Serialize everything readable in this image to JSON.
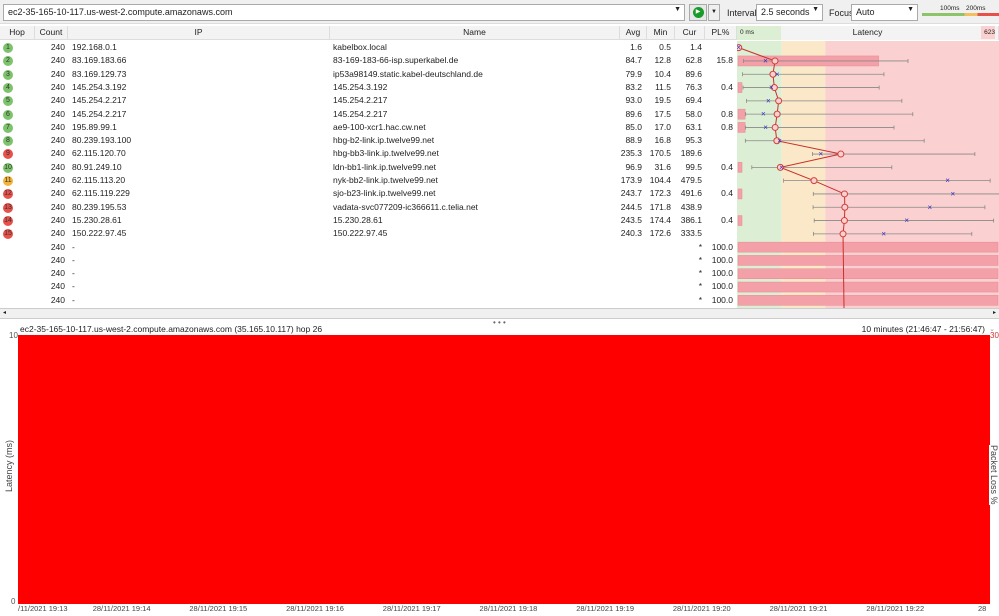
{
  "toolbar": {
    "target": "ec2-35-165-10-117.us-west-2.compute.amazonaws.com",
    "interval_label": "Interval",
    "interval": "2.5 seconds",
    "focus_label": "Focus",
    "focus": "Auto",
    "legend_100": "100ms",
    "legend_200": "200ms"
  },
  "columns": {
    "hop": "Hop",
    "count": "Count",
    "ip": "IP",
    "name": "Name",
    "avg": "Avg",
    "min": "Min",
    "cur": "Cur",
    "pl": "PL%",
    "latency": "Latency",
    "lat_min": "0 ms",
    "lat_max": "623"
  },
  "colors": {
    "good": "#7dc36b",
    "warn": "#f2b53a",
    "bad": "#e8504a",
    "green_zone": "#dcefd4",
    "yellow_zone": "#fbe8c8",
    "red_zone": "#fbd0d0"
  },
  "latency_scale_max_ms": 600,
  "hops": [
    {
      "hop": "1",
      "count": "240",
      "ip": "192.168.0.1",
      "name": "kabelbox.local",
      "avg": "1.6",
      "min": "0.5",
      "cur": "1.4",
      "pl": "",
      "max": 5,
      "status": "good"
    },
    {
      "hop": "2",
      "count": "240",
      "ip": "83.169.183.66",
      "name": "83-169-183-66-isp.superkabel.de",
      "avg": "84.7",
      "min": "12.8",
      "cur": "62.8",
      "pl": "15.8",
      "max": 389,
      "status": "good"
    },
    {
      "hop": "3",
      "count": "240",
      "ip": "83.169.129.73",
      "name": "ip53a98149.static.kabel-deutschland.de",
      "avg": "79.9",
      "min": "10.4",
      "cur": "89.6",
      "pl": "",
      "max": 334,
      "status": "good"
    },
    {
      "hop": "4",
      "count": "240",
      "ip": "145.254.3.192",
      "name": "145.254.3.192",
      "avg": "83.2",
      "min": "11.5",
      "cur": "76.3",
      "pl": "0.4",
      "max": 323,
      "status": "good"
    },
    {
      "hop": "5",
      "count": "240",
      "ip": "145.254.2.217",
      "name": "145.254.2.217",
      "avg": "93.0",
      "min": "19.5",
      "cur": "69.4",
      "pl": "",
      "max": 375,
      "status": "good"
    },
    {
      "hop": "6",
      "count": "240",
      "ip": "145.254.2.217",
      "name": "145.254.2.217",
      "avg": "89.6",
      "min": "17.5",
      "cur": "58.0",
      "pl": "0.8",
      "max": 400,
      "status": "good"
    },
    {
      "hop": "7",
      "count": "240",
      "ip": "195.89.99.1",
      "name": "ae9-100-xcr1.hac.cw.net",
      "avg": "85.0",
      "min": "17.0",
      "cur": "63.1",
      "pl": "0.8",
      "max": 357,
      "status": "good"
    },
    {
      "hop": "8",
      "count": "240",
      "ip": "80.239.193.100",
      "name": "hbg-b2-link.ip.twelve99.net",
      "avg": "88.9",
      "min": "16.8",
      "cur": "95.3",
      "pl": "",
      "max": 426,
      "status": "good"
    },
    {
      "hop": "9",
      "count": "240",
      "ip": "62.115.120.70",
      "name": "hbg-bb3-link.ip.twelve99.net",
      "avg": "235.3",
      "min": "170.5",
      "cur": "189.6",
      "pl": "",
      "max": 542,
      "status": "bad"
    },
    {
      "hop": "10",
      "count": "240",
      "ip": "80.91.249.10",
      "name": "ldn-bb1-link.ip.twelve99.net",
      "avg": "96.9",
      "min": "31.6",
      "cur": "99.5",
      "pl": "0.4",
      "max": 352,
      "status": "good"
    },
    {
      "hop": "11",
      "count": "240",
      "ip": "62.115.113.20",
      "name": "nyk-bb2-link.ip.twelve99.net",
      "avg": "173.9",
      "min": "104.4",
      "cur": "479.5",
      "pl": "",
      "max": 577,
      "status": "warn"
    },
    {
      "hop": "12",
      "count": "240",
      "ip": "62.115.119.229",
      "name": "sjo-b23-link.ip.twelve99.net",
      "avg": "243.7",
      "min": "172.3",
      "cur": "491.6",
      "pl": "0.4",
      "max": 600,
      "status": "bad"
    },
    {
      "hop": "13",
      "count": "240",
      "ip": "80.239.195.53",
      "name": "vadata-svc077209-ic366611.c.telia.net",
      "avg": "244.5",
      "min": "171.8",
      "cur": "438.9",
      "pl": "",
      "max": 565,
      "status": "bad"
    },
    {
      "hop": "14",
      "count": "240",
      "ip": "15.230.28.61",
      "name": "15.230.28.61",
      "avg": "243.5",
      "min": "174.4",
      "cur": "386.1",
      "pl": "0.4",
      "max": 585,
      "status": "bad"
    },
    {
      "hop": "15",
      "count": "240",
      "ip": "150.222.97.45",
      "name": "150.222.97.45",
      "avg": "240.3",
      "min": "172.6",
      "cur": "333.5",
      "pl": "",
      "max": 535,
      "status": "bad"
    },
    {
      "hop": "",
      "count": "240",
      "ip": "-",
      "name": "",
      "avg": "",
      "min": "",
      "cur": "*",
      "pl": "100.0",
      "status": "none"
    },
    {
      "hop": "",
      "count": "240",
      "ip": "-",
      "name": "",
      "avg": "",
      "min": "",
      "cur": "*",
      "pl": "100.0",
      "status": "none"
    },
    {
      "hop": "",
      "count": "240",
      "ip": "-",
      "name": "",
      "avg": "",
      "min": "",
      "cur": "*",
      "pl": "100.0",
      "status": "none"
    },
    {
      "hop": "",
      "count": "240",
      "ip": "-",
      "name": "",
      "avg": "",
      "min": "",
      "cur": "*",
      "pl": "100.0",
      "status": "none"
    },
    {
      "hop": "",
      "count": "240",
      "ip": "-",
      "name": "",
      "avg": "",
      "min": "",
      "cur": "*",
      "pl": "100.0",
      "status": "none"
    }
  ],
  "graph": {
    "title": "ec2-35-165-10-117.us-west-2.compute.amazonaws.com (35.165.10.117) hop 26",
    "range": "10 minutes (21:46:47 - 21:56:47)",
    "y_left_max": "10",
    "y_left_min": "0",
    "y_right_max": "30",
    "y_left_label": "Latency (ms)",
    "y_right_label": "Packet Loss %",
    "x_labels": [
      "/11/2021 19:13",
      "28/11/2021 19:14",
      "28/11/2021 19:15",
      "28/11/2021 19:16",
      "28/11/2021 19:17",
      "28/11/2021 19:18",
      "28/11/2021 19:19",
      "28/11/2021 19:20",
      "28/11/2021 19:21",
      "28/11/2021 19:22",
      "28"
    ]
  }
}
